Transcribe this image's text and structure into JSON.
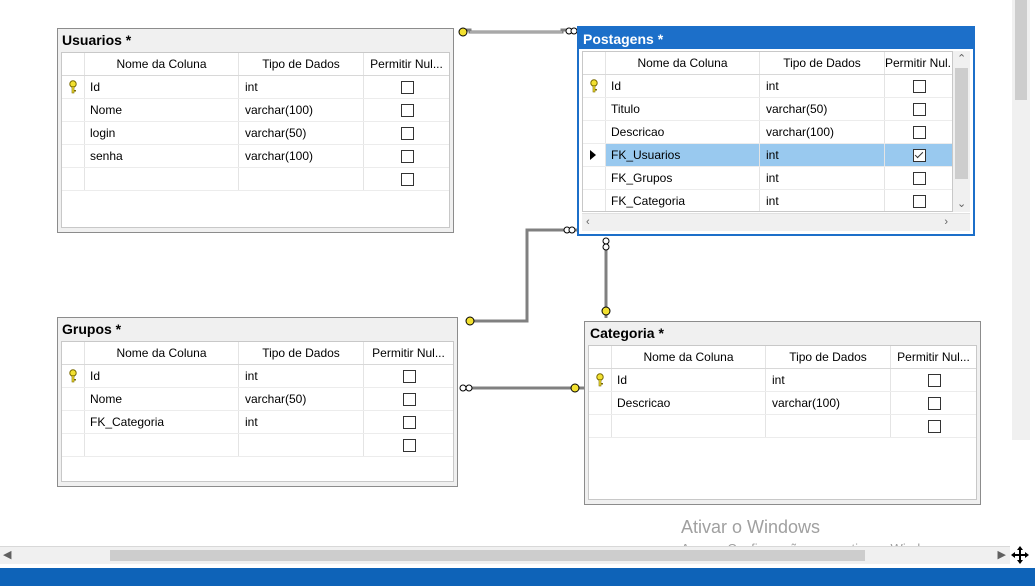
{
  "columns_header": {
    "name": "Nome da Coluna",
    "type": "Tipo de Dados",
    "nullable": "Permitir Nul..."
  },
  "tables": {
    "usuarios": {
      "title": "Usuarios *",
      "rows": [
        {
          "name": "Id",
          "type": "int",
          "nullable": false,
          "pk": true
        },
        {
          "name": "Nome",
          "type": "varchar(100)",
          "nullable": false
        },
        {
          "name": "login",
          "type": "varchar(50)",
          "nullable": false
        },
        {
          "name": "senha",
          "type": "varchar(100)",
          "nullable": false
        }
      ]
    },
    "postagens": {
      "title": "Postagens *",
      "rows": [
        {
          "name": "Id",
          "type": "int",
          "nullable": false,
          "pk": true
        },
        {
          "name": "Titulo",
          "type": "varchar(50)",
          "nullable": false
        },
        {
          "name": "Descricao",
          "type": "varchar(100)",
          "nullable": false
        },
        {
          "name": "FK_Usuarios",
          "type": "int",
          "nullable": true,
          "selected": true
        },
        {
          "name": "FK_Grupos",
          "type": "int",
          "nullable": false
        },
        {
          "name": "FK_Categoria",
          "type": "int",
          "nullable": false
        }
      ]
    },
    "grupos": {
      "title": "Grupos *",
      "rows": [
        {
          "name": "Id",
          "type": "int",
          "nullable": false,
          "pk": true
        },
        {
          "name": "Nome",
          "type": "varchar(50)",
          "nullable": false
        },
        {
          "name": "FK_Categoria",
          "type": "int",
          "nullable": false
        }
      ]
    },
    "categoria": {
      "title": "Categoria *",
      "rows": [
        {
          "name": "Id",
          "type": "int",
          "nullable": false,
          "pk": true
        },
        {
          "name": "Descricao",
          "type": "varchar(100)",
          "nullable": false
        }
      ]
    }
  },
  "watermark": {
    "line1": "Ativar o Windows",
    "line2": "Acesse Configurações para ativar o Windows."
  },
  "colors": {
    "selected_title": "#1c6fc9",
    "selected_row": "#99c9ef",
    "key_icon": "#e8d000",
    "taskbar": "#0e63b8"
  }
}
